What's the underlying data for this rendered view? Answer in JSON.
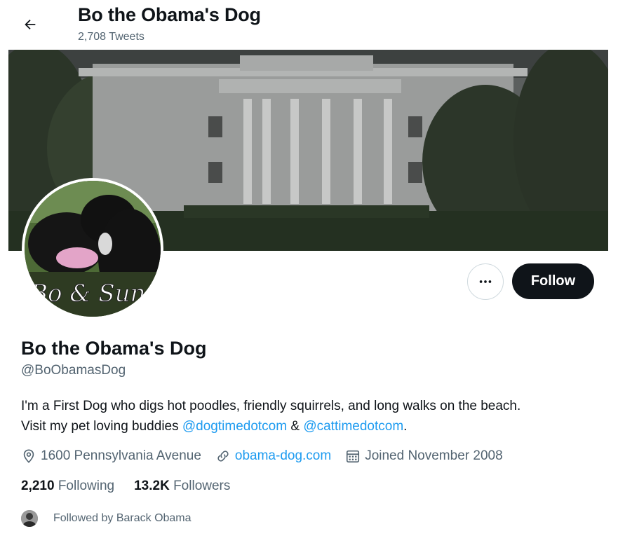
{
  "header": {
    "title": "Bo the Obama's Dog",
    "tweet_count": "2,708 Tweets",
    "back_icon": "arrow-left-icon"
  },
  "banner": {
    "image": "white-house-photo"
  },
  "avatar": {
    "image": "dogs-photo",
    "caption": "Bo & Sunny"
  },
  "actions": {
    "more_icon": "ellipsis-icon",
    "follow_label": "Follow"
  },
  "profile": {
    "name": "Bo the Obama's Dog",
    "handle": "@BoObamasDog",
    "bio_line1": "I'm a First Dog who digs hot poodles, friendly squirrels, and long walks on the beach.",
    "bio_line2_prefix": "Visit my pet loving buddies ",
    "bio_mention1": "@dogtimedotcom",
    "bio_conj": " & ",
    "bio_mention2": "@cattimedotcom",
    "bio_suffix": "."
  },
  "meta": {
    "location": "1600 Pennsylvania Avenue",
    "website": "obama-dog.com",
    "joined": "Joined November 2008"
  },
  "stats": {
    "following_count": "2,210",
    "following_label": "Following",
    "followers_count": "13.2K",
    "followers_label": "Followers"
  },
  "followed_by": {
    "text": "Followed by Barack Obama"
  },
  "colors": {
    "link": "#1d9bf0",
    "text": "#0f1419",
    "muted": "#536471",
    "button": "#0f1419"
  }
}
